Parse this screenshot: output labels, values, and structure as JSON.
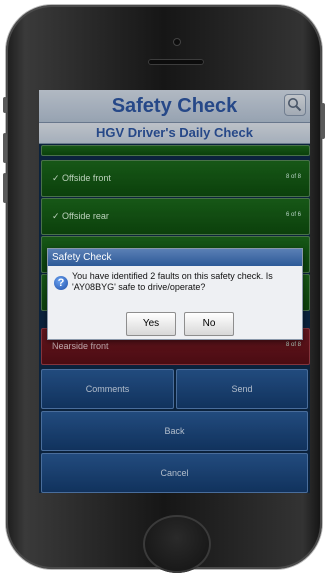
{
  "header": {
    "title": "Safety Check",
    "subtitle": "HGV Driver's Daily Check",
    "search_icon": "search-icon"
  },
  "checks": [
    {
      "label": "✓ Offside front",
      "count": "8 of 8",
      "status": "pass"
    },
    {
      "label": "✓ Offside rear",
      "count": "6 of 6",
      "status": "pass"
    },
    {
      "label": "Nearside front",
      "count": "8 of 8",
      "status": "fault"
    }
  ],
  "actions": {
    "comments": "Comments",
    "send": "Send",
    "back": "Back",
    "cancel": "Cancel"
  },
  "dialog": {
    "title": "Safety Check",
    "message": "You have identified 2 faults on this safety check. Is 'AY08BYG' safe to drive/operate?",
    "yes": "Yes",
    "no": "No",
    "icon": "question-icon"
  },
  "colors": {
    "pass": "#1c6b1c",
    "fault": "#7a1b25",
    "accent": "#2f58a6"
  }
}
